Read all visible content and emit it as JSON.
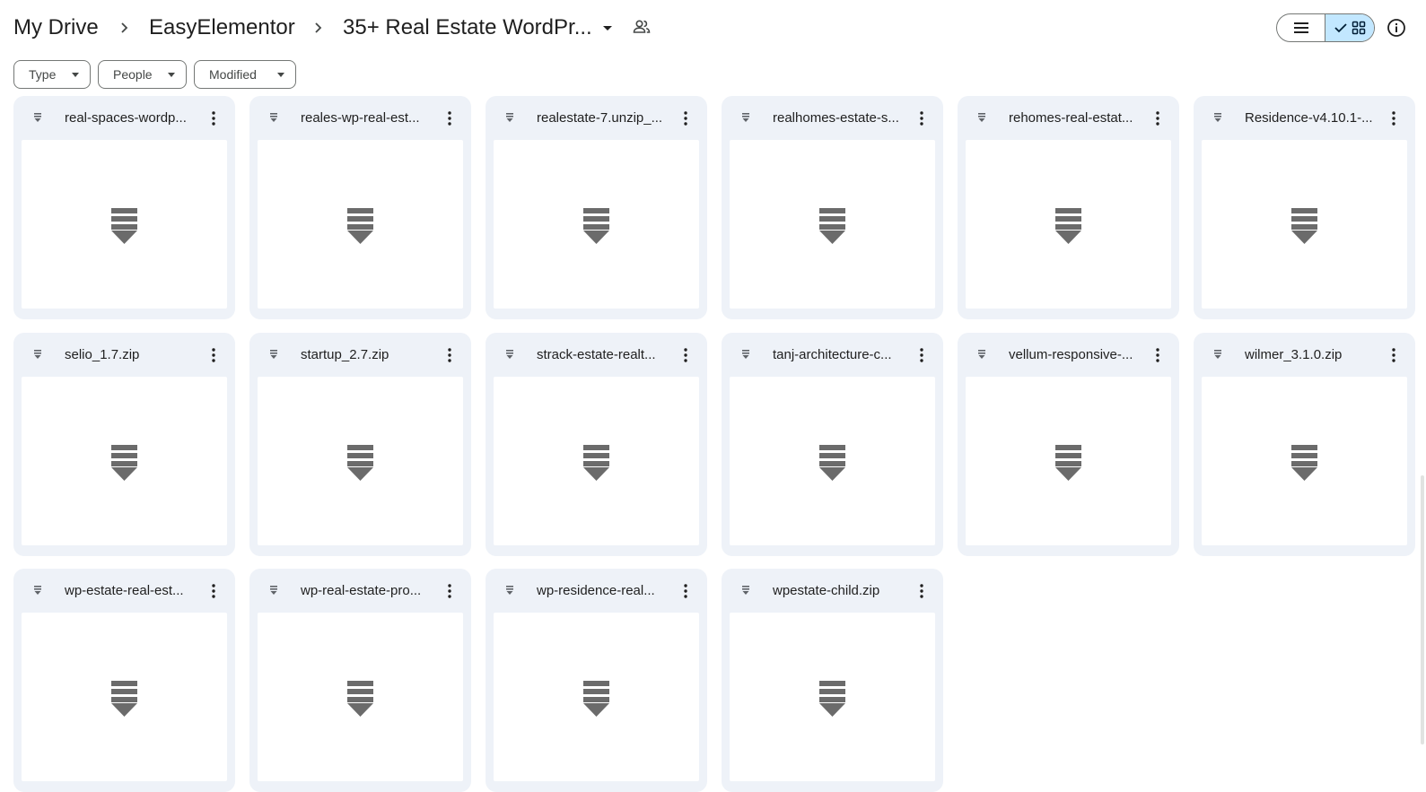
{
  "breadcrumb": {
    "items": [
      "My Drive",
      "EasyElementor",
      "35+ Real Estate WordPr..."
    ]
  },
  "filters": {
    "type_label": "Type",
    "people_label": "People",
    "modified_label": "Modified"
  },
  "view": {
    "mode": "grid"
  },
  "files": [
    {
      "name": "real-spaces-wordp..."
    },
    {
      "name": "reales-wp-real-est..."
    },
    {
      "name": "realestate-7.unzip_..."
    },
    {
      "name": "realhomes-estate-s..."
    },
    {
      "name": "rehomes-real-estat..."
    },
    {
      "name": "Residence-v4.10.1-..."
    },
    {
      "name": "selio_1.7.zip"
    },
    {
      "name": "startup_2.7.zip"
    },
    {
      "name": "strack-estate-realt..."
    },
    {
      "name": "tanj-architecture-c..."
    },
    {
      "name": "vellum-responsive-..."
    },
    {
      "name": "wilmer_3.1.0.zip"
    },
    {
      "name": "wp-estate-real-est..."
    },
    {
      "name": "wp-real-estate-pro..."
    },
    {
      "name": "wp-residence-real..."
    },
    {
      "name": "wpestate-child.zip"
    }
  ],
  "colors": {
    "card_bg": "#eef2f8",
    "selected_toggle": "#c2e7ff",
    "icon_gray": "#5f6368",
    "zip_icon": "#6b6b6b"
  }
}
